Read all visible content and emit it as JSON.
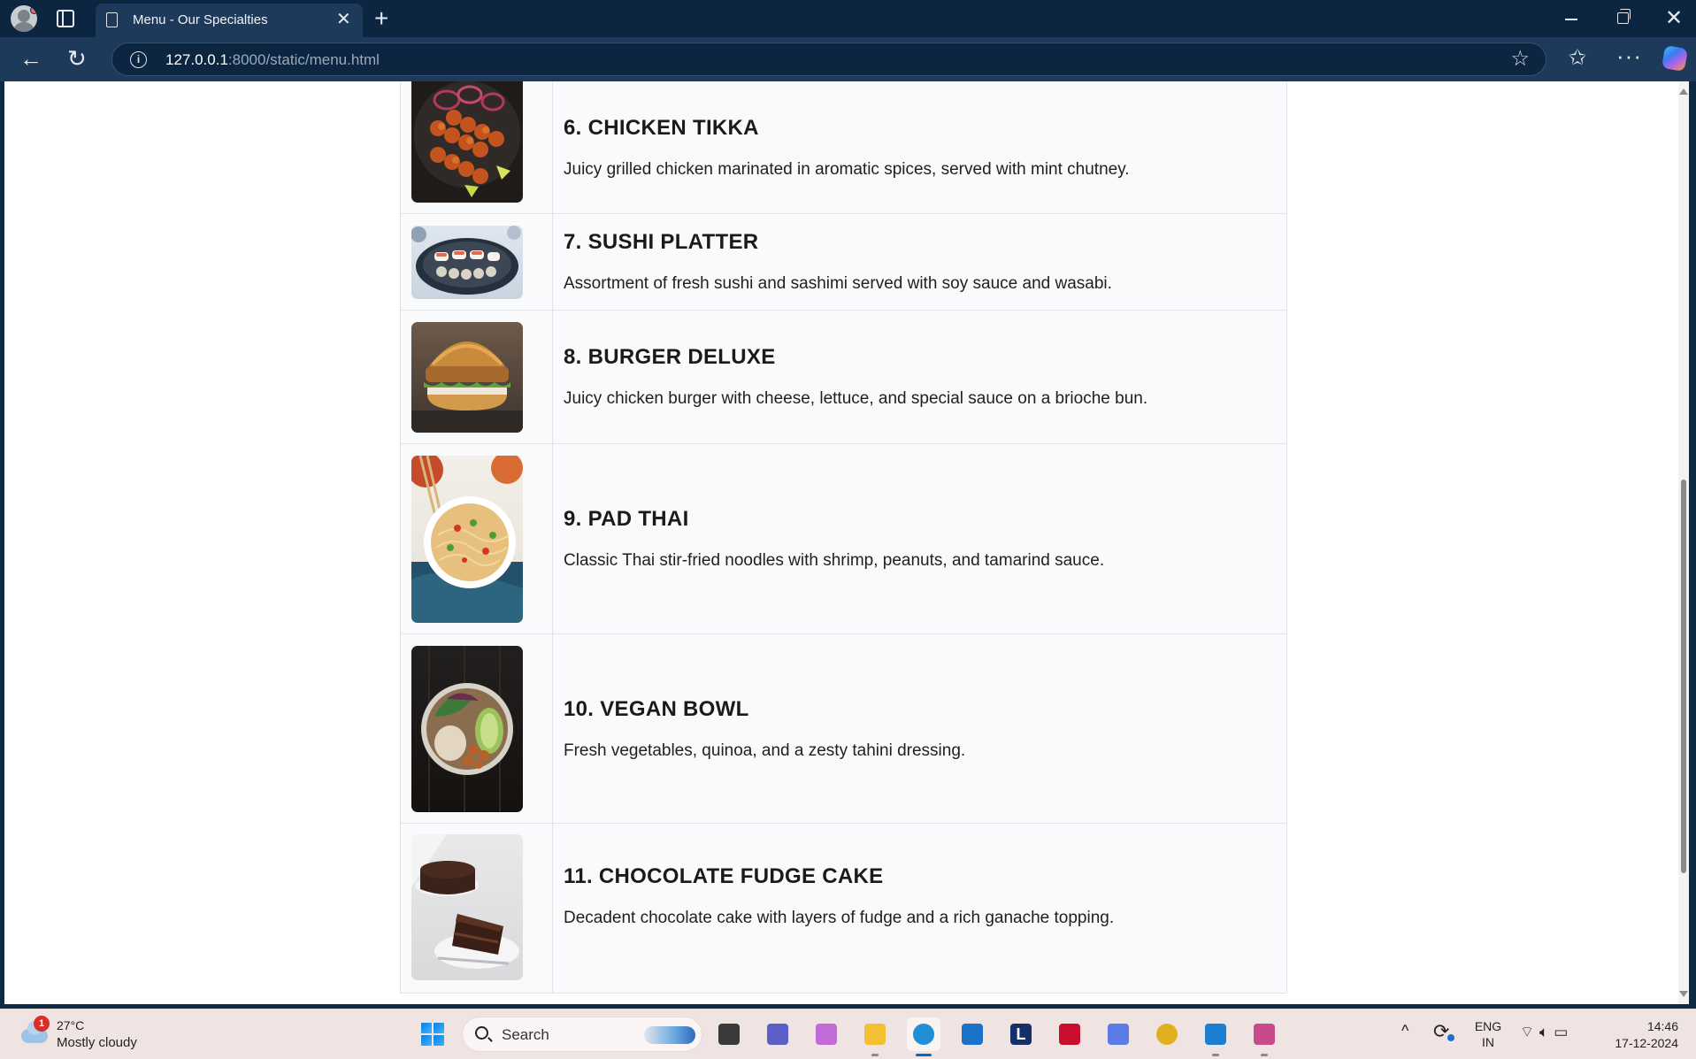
{
  "browser": {
    "tab_title": "Menu - Our Specialties",
    "url_host": "127.0.0.1",
    "url_path": ":8000/static/menu.html"
  },
  "menu": {
    "items": [
      {
        "name": "6. CHICKEN TIKKA",
        "description": "Juicy grilled chicken marinated in aromatic spices, served with mint chutney."
      },
      {
        "name": "7. SUSHI PLATTER",
        "description": "Assortment of fresh sushi and sashimi served with soy sauce and wasabi."
      },
      {
        "name": "8. BURGER DELUXE",
        "description": "Juicy chicken burger with cheese, lettuce, and special sauce on a brioche bun."
      },
      {
        "name": "9. PAD THAI",
        "description": "Classic Thai stir-fried noodles with shrimp, peanuts, and tamarind sauce."
      },
      {
        "name": "10. VEGAN BOWL",
        "description": "Fresh vegetables, quinoa, and a zesty tahini dressing."
      },
      {
        "name": "11. CHOCOLATE FUDGE CAKE",
        "description": "Decadent chocolate cake with layers of fudge and a rich ganache topping."
      }
    ]
  },
  "taskbar": {
    "weather_badge": "1",
    "temperature": "27°C",
    "condition": "Mostly cloudy",
    "search_label": "Search",
    "lang_line1": "ENG",
    "lang_line2": "IN",
    "time": "14:46",
    "date": "17-12-2024",
    "apps": [
      {
        "name": "file-explorer-dark",
        "color": "#3a3a3a",
        "letter": ""
      },
      {
        "name": "teams",
        "color": "#5b5fc7",
        "letter": ""
      },
      {
        "name": "copilot",
        "color": "#c26ad8",
        "letter": ""
      },
      {
        "name": "file-explorer",
        "color": "#f3c034",
        "letter": ""
      },
      {
        "name": "edge",
        "color": "#1f8fd6",
        "letter": ""
      },
      {
        "name": "microsoft-store",
        "color": "#1a73c9",
        "letter": ""
      },
      {
        "name": "l-app",
        "color": "#14306b",
        "letter": "L"
      },
      {
        "name": "mcafee",
        "color": "#c8102e",
        "letter": ""
      },
      {
        "name": "vpn-app",
        "color": "#5b7be6",
        "letter": ""
      },
      {
        "name": "chrome",
        "color": "#e0b021",
        "letter": ""
      },
      {
        "name": "vscode",
        "color": "#1c7fd1",
        "letter": ""
      },
      {
        "name": "snipping-tool",
        "color": "#c94a8b",
        "letter": ""
      }
    ]
  },
  "colors": {
    "titlebar": "#0c2540",
    "toolbar": "#1d3a5b",
    "taskbar": "#f0e4e3",
    "accent": "#0a66c2"
  }
}
